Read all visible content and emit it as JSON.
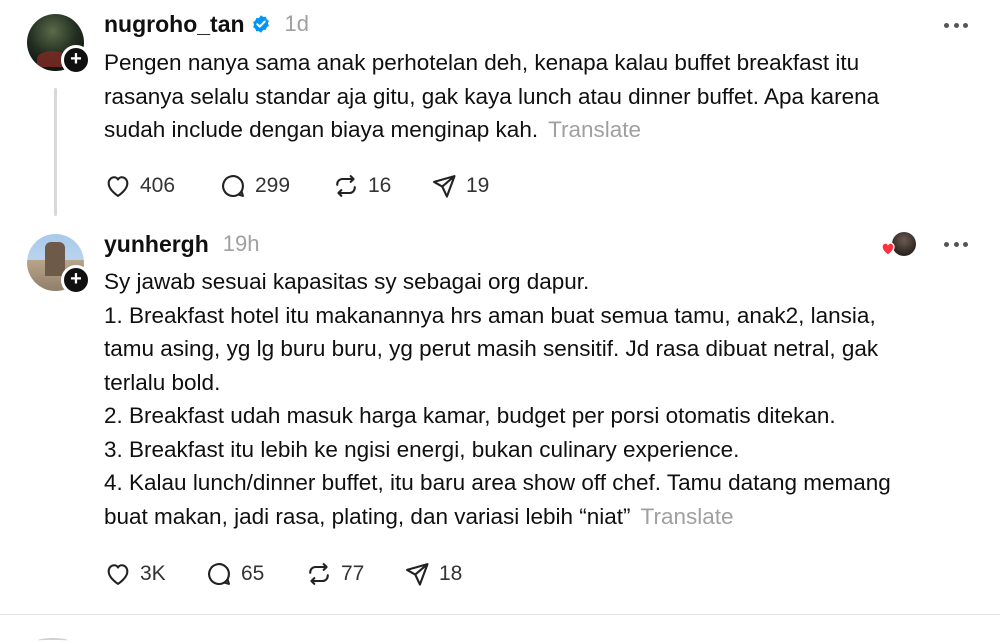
{
  "posts": [
    {
      "username": "nugroho_tan",
      "verified": true,
      "time": "1d",
      "text": "Pengen nanya sama anak perhotelan deh, kenapa kalau buffet breakfast itu\nrasanya selalu standar aja gitu, gak kaya lunch atau dinner buffet. Apa karena\nsudah include dengan biaya menginap kah.",
      "translate_label": "Translate",
      "likes": "406",
      "replies": "299",
      "reposts": "16",
      "shares": "19",
      "avatar_icon": "profile-avatar",
      "follow_icon": "plus-icon"
    },
    {
      "username": "yunhergh",
      "verified": false,
      "time": "19h",
      "text": "Sy jawab sesuai kapasitas sy sebagai org dapur.\n1. Breakfast hotel itu makanannya hrs aman buat semua tamu, anak2, lansia,\ntamu asing, yg lg buru buru, yg perut masih sensitif. Jd rasa dibuat netral, gak\nterlalu bold.\n2. Breakfast udah masuk harga kamar, budget per porsi otomatis ditekan.\n3. Breakfast itu lebih ke ngisi energi, bukan culinary experience.\n4. Kalau lunch/dinner buffet, itu baru area show off chef. Tamu datang memang\nbuat makan, jadi rasa, plating, dan variasi lebih “niat”",
      "translate_label": "Translate",
      "likes": "3K",
      "replies": "65",
      "reposts": "77",
      "shares": "18",
      "liked_by_author_icon": "heart-icon",
      "avatar_icon": "profile-avatar",
      "follow_icon": "plus-icon"
    }
  ],
  "colors": {
    "text": "#101010",
    "muted": "#a0a0a0",
    "verified": "#0095f6",
    "heart": "#ff3040",
    "divider": "#e3e3e3"
  }
}
